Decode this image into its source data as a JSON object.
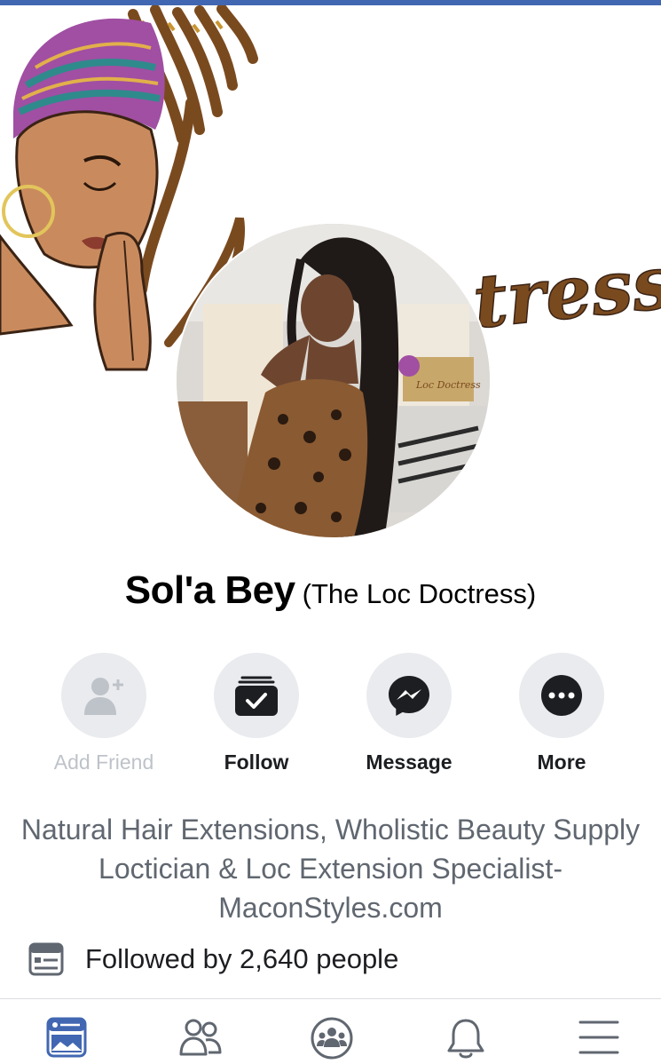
{
  "profile": {
    "name": "Sol'a Bey",
    "alternate_name": "(The Loc Doctress)",
    "cover_text": "tress",
    "avatar_watermark": "Loc Doctress"
  },
  "actions": [
    {
      "label": "Add Friend",
      "icon": "add-friend-icon",
      "enabled": false
    },
    {
      "label": "Follow",
      "icon": "follow-icon",
      "enabled": true
    },
    {
      "label": "Message",
      "icon": "messenger-icon",
      "enabled": true
    },
    {
      "label": "More",
      "icon": "more-icon",
      "enabled": true
    }
  ],
  "bio": "Natural Hair Extensions, Wholistic Beauty Supply Loctician & Loc Extension Specialist- MaconStyles.com",
  "followers": {
    "icon": "page-card-icon",
    "text": "Followed by 2,640 people"
  },
  "tabbar": [
    {
      "name": "news-feed",
      "icon": "news-feed-icon",
      "active": true
    },
    {
      "name": "friends",
      "icon": "friends-icon",
      "active": false
    },
    {
      "name": "groups",
      "icon": "groups-icon",
      "active": false
    },
    {
      "name": "notifications",
      "icon": "bell-icon",
      "active": false
    },
    {
      "name": "menu",
      "icon": "hamburger-menu-icon",
      "active": false
    }
  ],
  "colors": {
    "brand": "#4267b2",
    "icon_dark": "#1c1e21",
    "muted_text": "#606770",
    "disabled": "#bec3c9",
    "circle_bg": "#e9ebee",
    "cover_brown": "#7a4a1f"
  }
}
